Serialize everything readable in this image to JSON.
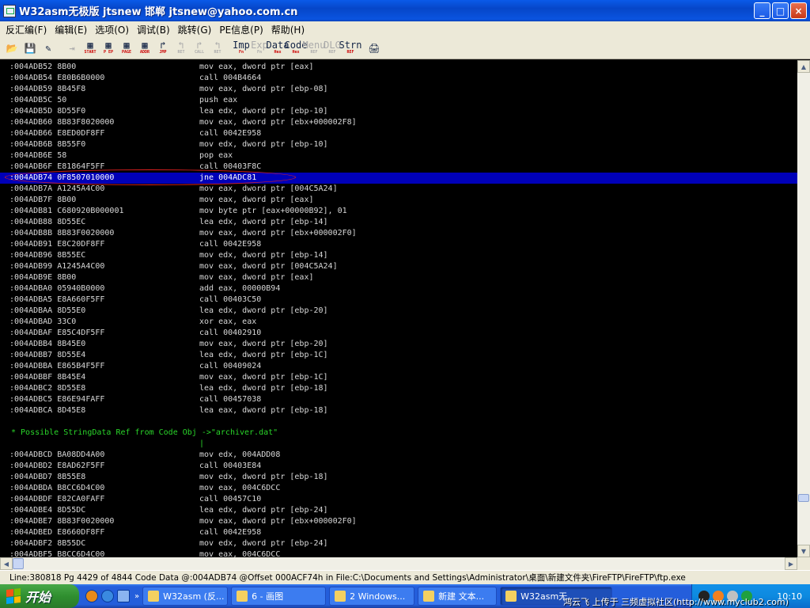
{
  "window": {
    "title": "W32asm无极版 jtsnew 邯郸  jtsnew@yahoo.com.cn",
    "buttons": {
      "minimize": "_",
      "maximize": "□",
      "close": "×"
    }
  },
  "menu": [
    "反汇编(F)",
    "编辑(E)",
    "选项(O)",
    "调试(B)",
    "跳转(G)",
    "PE信息(P)",
    "帮助(H)"
  ],
  "toolbar": [
    {
      "name": "open",
      "glyph": "📂",
      "sub": ""
    },
    {
      "name": "save",
      "glyph": "💾",
      "sub": ""
    },
    {
      "name": "find",
      "glyph": "✎",
      "sub": ""
    },
    {
      "name": "goto-disabled",
      "glyph": "⇥",
      "sub": "",
      "disabled": true
    },
    {
      "name": "start",
      "glyph": "▦",
      "sub": "START"
    },
    {
      "name": "pep",
      "glyph": "▦",
      "sub": "P EP"
    },
    {
      "name": "page",
      "glyph": "▦",
      "sub": "PAGE"
    },
    {
      "name": "addr",
      "glyph": "▦",
      "sub": "ADDR"
    },
    {
      "name": "jmp",
      "glyph": "↱",
      "sub": "JMP"
    },
    {
      "name": "ret",
      "glyph": "↰",
      "sub": "RET",
      "disabled": true
    },
    {
      "name": "call",
      "glyph": "↱",
      "sub": "CALL",
      "disabled": true
    },
    {
      "name": "ret2",
      "glyph": "↰",
      "sub": "RET",
      "disabled": true
    },
    {
      "name": "imp",
      "glyph": "Imp",
      "sub": "Fn"
    },
    {
      "name": "exp",
      "glyph": "Exp",
      "sub": "Fn",
      "disabled": true
    },
    {
      "name": "data",
      "glyph": "Data",
      "sub": "Hex"
    },
    {
      "name": "code",
      "glyph": "Code",
      "sub": "Hex"
    },
    {
      "name": "menu",
      "glyph": "Menu",
      "sub": "REF",
      "disabled": true
    },
    {
      "name": "dlg",
      "glyph": "DLG",
      "sub": "REF",
      "disabled": true
    },
    {
      "name": "strn",
      "glyph": "Strn",
      "sub": "REF"
    },
    {
      "name": "print",
      "glyph": "🖨",
      "sub": ""
    }
  ],
  "code_lines": [
    {
      "addr": ":004ADB52 8B00",
      "instr": "mov eax, dword ptr [eax]"
    },
    {
      "addr": ":004ADB54 E80B6B0000",
      "instr": "call 004B4664"
    },
    {
      "addr": ":004ADB59 8B45F8",
      "instr": "mov eax, dword ptr [ebp-08]"
    },
    {
      "addr": ":004ADB5C 50",
      "instr": "push eax"
    },
    {
      "addr": ":004ADB5D 8D55F0",
      "instr": "lea edx, dword ptr [ebp-10]"
    },
    {
      "addr": ":004ADB60 8B83F8020000",
      "instr": "mov eax, dword ptr [ebx+000002F8]"
    },
    {
      "addr": ":004ADB66 E8ED0DF8FF",
      "instr": "call 0042E958"
    },
    {
      "addr": ":004ADB6B 8B55F0",
      "instr": "mov edx, dword ptr [ebp-10]"
    },
    {
      "addr": ":004ADB6E 58",
      "instr": "pop eax"
    },
    {
      "addr": ":004ADB6F E81864F5FF",
      "instr": "call 00403F8C"
    },
    {
      "addr": ":004ADB74 0F8507010000",
      "instr": "jne 004ADC81",
      "selected": true
    },
    {
      "addr": ":004ADB7A A1245A4C00",
      "instr": "mov eax, dword ptr [004C5A24]"
    },
    {
      "addr": ":004ADB7F 8B00",
      "instr": "mov eax, dword ptr [eax]"
    },
    {
      "addr": ":004ADB81 C680920B000001",
      "instr": "mov byte ptr [eax+00000B92], 01"
    },
    {
      "addr": ":004ADB88 8D55EC",
      "instr": "lea edx, dword ptr [ebp-14]"
    },
    {
      "addr": ":004ADB8B 8B83F0020000",
      "instr": "mov eax, dword ptr [ebx+000002F0]"
    },
    {
      "addr": ":004ADB91 E8C20DF8FF",
      "instr": "call 0042E958"
    },
    {
      "addr": ":004ADB96 8B55EC",
      "instr": "mov edx, dword ptr [ebp-14]"
    },
    {
      "addr": ":004ADB99 A1245A4C00",
      "instr": "mov eax, dword ptr [004C5A24]"
    },
    {
      "addr": ":004ADB9E 8B00",
      "instr": "mov eax, dword ptr [eax]"
    },
    {
      "addr": ":004ADBA0 05940B0000",
      "instr": "add eax, 00000B94"
    },
    {
      "addr": ":004ADBA5 E8A660F5FF",
      "instr": "call 00403C50"
    },
    {
      "addr": ":004ADBAA 8D55E0",
      "instr": "lea edx, dword ptr [ebp-20]"
    },
    {
      "addr": ":004ADBAD 33C0",
      "instr": "xor eax, eax"
    },
    {
      "addr": ":004ADBAF E85C4DF5FF",
      "instr": "call 00402910"
    },
    {
      "addr": ":004ADBB4 8B45E0",
      "instr": "mov eax, dword ptr [ebp-20]"
    },
    {
      "addr": ":004ADBB7 8D55E4",
      "instr": "lea edx, dword ptr [ebp-1C]"
    },
    {
      "addr": ":004ADBBA E865B4F5FF",
      "instr": "call 00409024"
    },
    {
      "addr": ":004ADBBF 8B45E4",
      "instr": "mov eax, dword ptr [ebp-1C]"
    },
    {
      "addr": ":004ADBC2 8D55E8",
      "instr": "lea edx, dword ptr [ebp-18]"
    },
    {
      "addr": ":004ADBC5 E86E94FAFF",
      "instr": "call 00457038"
    },
    {
      "addr": ":004ADBCA 8D45E8",
      "instr": "lea eax, dword ptr [ebp-18]"
    },
    {
      "addr": "",
      "instr": ""
    },
    {
      "ref": "* Possible StringData Ref from Code Obj ->\"archiver.dat\""
    },
    {
      "pipe": "|"
    },
    {
      "addr": ":004ADBCD BA08DD4A00",
      "instr": "mov edx, 004ADD08"
    },
    {
      "addr": ":004ADBD2 E8AD62F5FF",
      "instr": "call 00403E84"
    },
    {
      "addr": ":004ADBD7 8B55E8",
      "instr": "mov edx, dword ptr [ebp-18]"
    },
    {
      "addr": ":004ADBDA B8CC6D4C00",
      "instr": "mov eax, 004C6DCC"
    },
    {
      "addr": ":004ADBDF E82CA0FAFF",
      "instr": "call 00457C10"
    },
    {
      "addr": ":004ADBE4 8D55DC",
      "instr": "lea edx, dword ptr [ebp-24]"
    },
    {
      "addr": ":004ADBE7 8B83F0020000",
      "instr": "mov eax, dword ptr [ebx+000002F0]"
    },
    {
      "addr": ":004ADBED E8660DF8FF",
      "instr": "call 0042E958"
    },
    {
      "addr": ":004ADBF2 8B55DC",
      "instr": "mov edx, dword ptr [ebp-24]"
    },
    {
      "addr": ":004ADBF5 B8CC6D4C00",
      "instr": "mov eax, 004C6DCC"
    }
  ],
  "statusbar": "Line:380818 Pg 4429 of 4844  Code Data @:004ADB74 @Offset 000ACF74h in File:C:\\Documents and Settings\\Administrator\\桌面\\新建文件夹\\FireFTP\\FireFTP\\ftp.exe",
  "taskbar": {
    "start_label": "开始",
    "tasks": [
      {
        "label": "W32asm (反...",
        "active": false
      },
      {
        "label": "6 - 画图",
        "active": false
      },
      {
        "label": "2 Windows...",
        "active": false
      },
      {
        "label": "新建 文本...",
        "active": false
      },
      {
        "label": "W32asm无...",
        "active": true
      }
    ],
    "clock": "10:10",
    "watermark": "鸿云飞 上传于  三频虚拟社区(http://www.myclub2.com)"
  },
  "colors": {
    "selection": "#0000b8",
    "reference": "#2ad62a",
    "ellipse": "#e02020"
  }
}
